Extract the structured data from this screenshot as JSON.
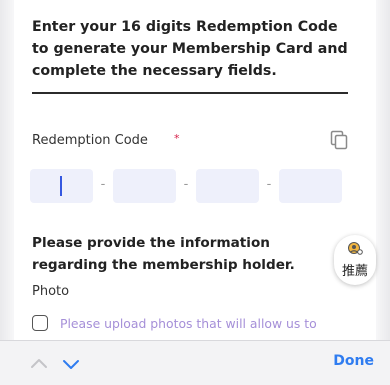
{
  "form": {
    "intro": "Enter your 16 digits Redemption Code to generate your Membership Card and complete the necessary fields.",
    "redemption_label": "Redemption Code",
    "required_mark": "*",
    "code_separator": "-",
    "holder_title": "Please provide the information regarding the membership holder.",
    "photo_label": "Photo",
    "upload_text": "Please upload photos that will allow us to recognize you while using the"
  },
  "recommend": {
    "label": "推薦"
  },
  "keyboard_toolbar": {
    "done_label": "Done"
  },
  "colors": {
    "accent": "#2f7cf0",
    "caret": "#3558e0",
    "required": "#d6214a",
    "upload_text": "#a58fd8",
    "code_box": "#eef0fb"
  },
  "icons": {
    "copy": "copy-icon",
    "recommend": "recommend-icon",
    "prev_field": "chevron-up-icon",
    "next_field": "chevron-down-icon",
    "checkbox": "checkbox-icon"
  }
}
